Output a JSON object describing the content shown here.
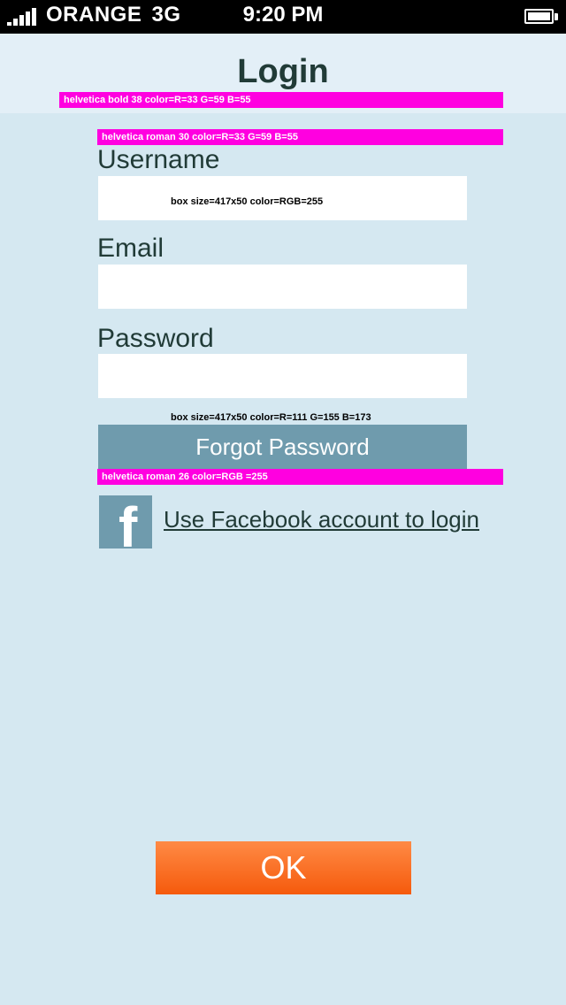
{
  "status_bar": {
    "carrier": "ORANGE",
    "network": "3G",
    "time": "9:20 PM"
  },
  "header": {
    "title": "Login"
  },
  "annotations": {
    "title_font": "helvetica bold 38 color=R=33 G=59 B=55",
    "label_font": "helvetica roman 30 color=R=33 G=59 B=55",
    "input_box": "box size=417x50 color=RGB=255",
    "button_box": "box size=417x50 color=R=111 G=155 B=173",
    "button_font": "helvetica roman 26 color=RGB =255"
  },
  "form": {
    "username_label": "Username",
    "username_value": "",
    "email_label": "Email",
    "email_value": "",
    "password_label": "Password",
    "password_value": ""
  },
  "buttons": {
    "forgot_password": "Forgot Password",
    "ok": "OK"
  },
  "facebook": {
    "icon": "facebook-icon",
    "icon_glyph": "f",
    "link_text": "Use Facebook account to login"
  },
  "colors": {
    "label_text": "#213b37",
    "button_bg": "#6f9bad",
    "ok_bg": "#f55a0c",
    "annotation_bg": "#ff00e0"
  }
}
